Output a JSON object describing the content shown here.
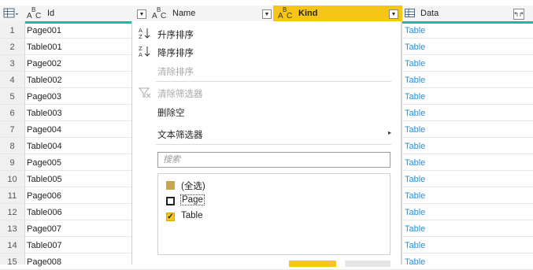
{
  "columns": {
    "id": {
      "label": "Id",
      "type_icon": "abc-text-type-icon"
    },
    "name": {
      "label": "Name",
      "type_icon": "abc-text-type-icon"
    },
    "kind": {
      "label": "Kind",
      "type_icon": "abc-text-type-icon"
    },
    "data": {
      "label": "Data",
      "type_icon": "table-type-icon"
    }
  },
  "rows": [
    {
      "num": "1",
      "id": "Page001",
      "data": "Table"
    },
    {
      "num": "2",
      "id": "Table001",
      "data": "Table"
    },
    {
      "num": "3",
      "id": "Page002",
      "data": "Table"
    },
    {
      "num": "4",
      "id": "Table002",
      "data": "Table"
    },
    {
      "num": "5",
      "id": "Page003",
      "data": "Table"
    },
    {
      "num": "6",
      "id": "Table003",
      "data": "Table"
    },
    {
      "num": "7",
      "id": "Page004",
      "data": "Table"
    },
    {
      "num": "8",
      "id": "Table004",
      "data": "Table"
    },
    {
      "num": "9",
      "id": "Page005",
      "data": "Table"
    },
    {
      "num": "10",
      "id": "Table005",
      "data": "Table"
    },
    {
      "num": "11",
      "id": "Page006",
      "data": "Table"
    },
    {
      "num": "12",
      "id": "Table006",
      "data": "Table"
    },
    {
      "num": "13",
      "id": "Page007",
      "data": "Table"
    },
    {
      "num": "14",
      "id": "Table007",
      "data": "Table"
    },
    {
      "num": "15",
      "id": "Page008",
      "data": "Table"
    }
  ],
  "menu": {
    "sort_asc": "升序排序",
    "sort_desc": "降序排序",
    "clear_sort": "清除排序",
    "clear_filter": "清除筛选器",
    "remove_empty": "删除空",
    "text_filters": "文本筛选器",
    "search_placeholder": "搜索",
    "options": [
      {
        "label": "(全选)",
        "state": "partial"
      },
      {
        "label": "Page",
        "state": "unchecked"
      },
      {
        "label": "Table",
        "state": "checked"
      }
    ]
  },
  "colors": {
    "accent": "#f5c518",
    "header_bar": "#1fb6a6",
    "link": "#2b8fd9"
  }
}
